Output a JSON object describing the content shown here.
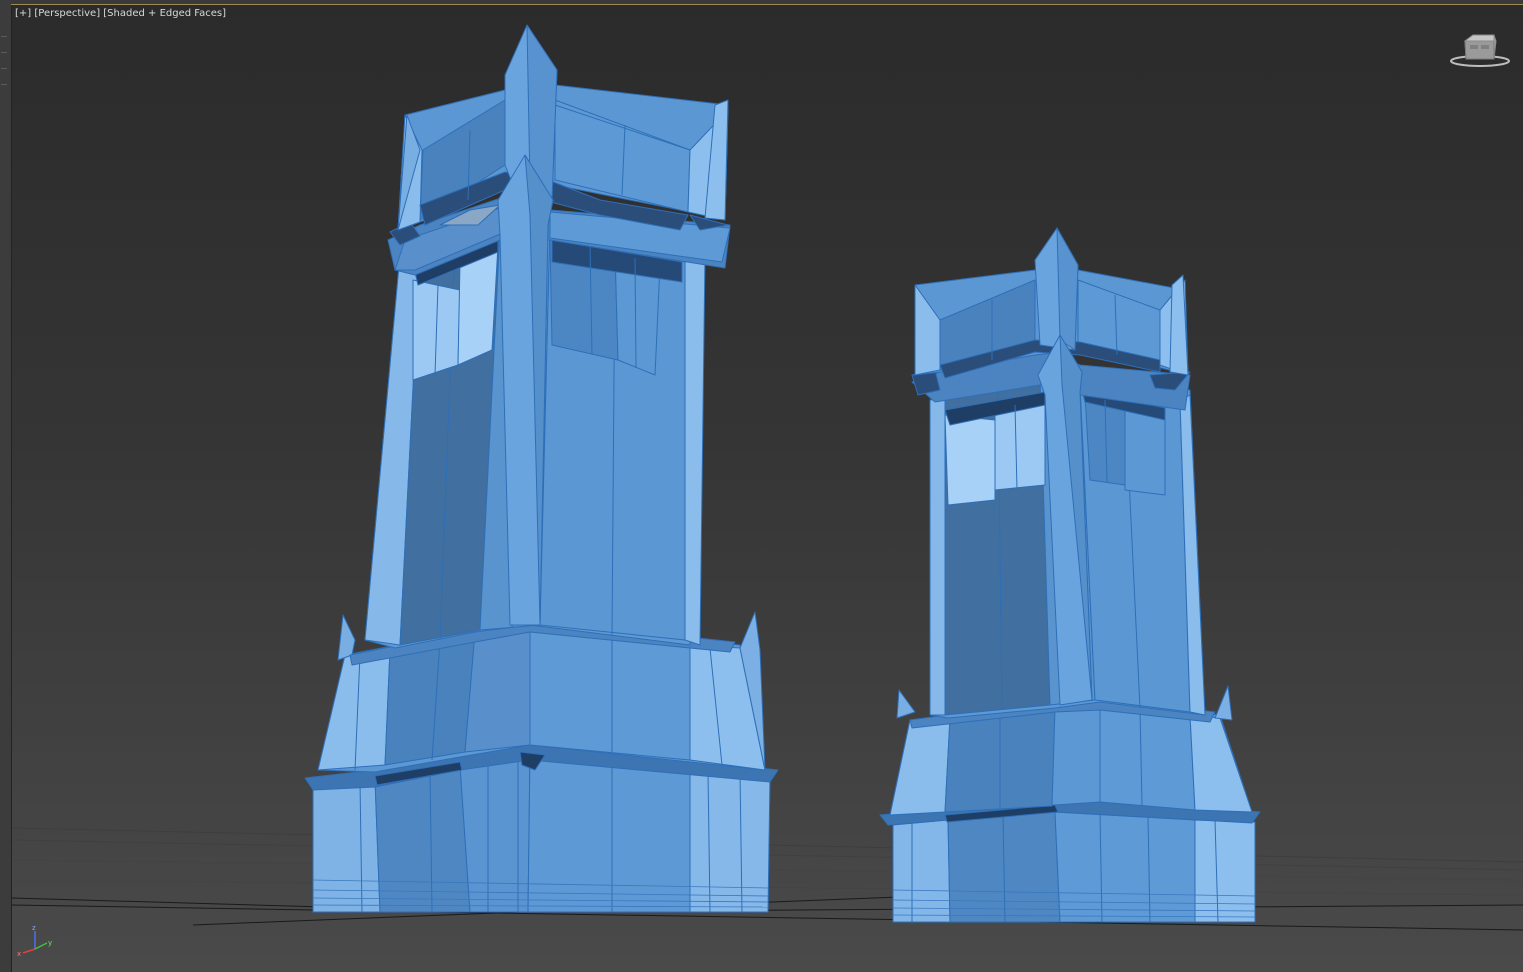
{
  "viewport": {
    "label_plus": "[+]",
    "label_view": "[Perspective]",
    "label_shading": "[Shaded + Edged Faces]",
    "view_cube_icon": "view-cube-icon",
    "axis_tripod_icon": "axis-tripod-icon",
    "axis_labels": {
      "x": "x",
      "y": "y",
      "z": "z"
    },
    "mesh_color": "#5a9ad6",
    "edge_color": "#2d6fb8",
    "background_top": "#2b2b2b",
    "background_bottom": "#4a4a4a"
  }
}
